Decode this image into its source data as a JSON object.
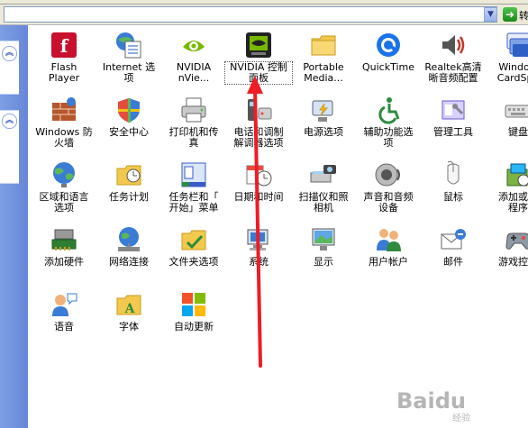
{
  "toolbar": {
    "go_label": "转"
  },
  "icons": [
    {
      "label": "Flash\nPlayer",
      "icon": "flash-icon"
    },
    {
      "label": "Internet 选\n项",
      "icon": "internet-options-icon"
    },
    {
      "label": "NVIDIA\nnVie...",
      "icon": "nvidia-nview-icon"
    },
    {
      "label": "NVIDIA 控制\n面板",
      "icon": "nvidia-control-panel-icon"
    },
    {
      "label": "Portable\nMedia...",
      "icon": "portable-media-icon"
    },
    {
      "label": "QuickTime",
      "icon": "quicktime-icon"
    },
    {
      "label": "Realtek高清\n晰音频配置",
      "icon": "realtek-audio-icon"
    },
    {
      "label": "Window\nCardSpa",
      "icon": "cardspace-icon"
    },
    {
      "label": "Windows 防\n火墙",
      "icon": "firewall-icon"
    },
    {
      "label": "安全中心",
      "icon": "security-center-icon"
    },
    {
      "label": "打印机和传\n真",
      "icon": "printer-icon"
    },
    {
      "label": "电话和调制\n解调器选项",
      "icon": "phone-modem-icon"
    },
    {
      "label": "电源选项",
      "icon": "power-options-icon"
    },
    {
      "label": "辅助功能选\n项",
      "icon": "accessibility-icon"
    },
    {
      "label": "管理工具",
      "icon": "admin-tools-icon"
    },
    {
      "label": "键盘",
      "icon": "keyboard-icon"
    },
    {
      "label": "区域和语言\n选项",
      "icon": "region-language-icon"
    },
    {
      "label": "任务计划",
      "icon": "scheduled-tasks-icon"
    },
    {
      "label": "任务栏和「\n开始」菜单",
      "icon": "taskbar-start-icon"
    },
    {
      "label": "日期和时间",
      "icon": "date-time-icon"
    },
    {
      "label": "扫描仪和照\n相机",
      "icon": "scanner-camera-icon"
    },
    {
      "label": "声音和音频\n设备",
      "icon": "sound-audio-icon"
    },
    {
      "label": "鼠标",
      "icon": "mouse-icon"
    },
    {
      "label": "添加或删\n程序",
      "icon": "add-remove-programs-icon"
    },
    {
      "label": "添加硬件",
      "icon": "add-hardware-icon"
    },
    {
      "label": "网络连接",
      "icon": "network-connections-icon"
    },
    {
      "label": "文件夹选项",
      "icon": "folder-options-icon"
    },
    {
      "label": "系统",
      "icon": "system-icon"
    },
    {
      "label": "显示",
      "icon": "display-icon"
    },
    {
      "label": "用户帐户",
      "icon": "user-accounts-icon"
    },
    {
      "label": "邮件",
      "icon": "mail-icon"
    },
    {
      "label": "游戏控制",
      "icon": "game-controllers-icon"
    },
    {
      "label": "语音",
      "icon": "speech-icon"
    },
    {
      "label": "字体",
      "icon": "fonts-icon"
    },
    {
      "label": "自动更新",
      "icon": "automatic-updates-icon"
    }
  ],
  "watermark": {
    "brand": "Baidu",
    "sub": "经验"
  },
  "colors": {
    "annotation_arrow": "#ee1c25",
    "sidebar": "#6f8fdc"
  }
}
